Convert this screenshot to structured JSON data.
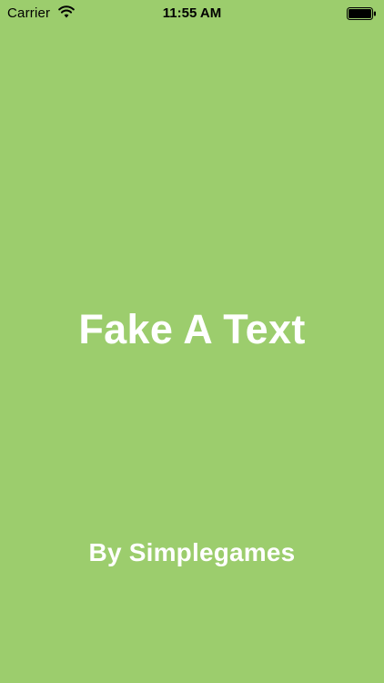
{
  "status_bar": {
    "carrier": "Carrier",
    "time": "11:55 AM",
    "wifi_icon": "wifi-icon",
    "battery_icon": "battery-icon"
  },
  "splash": {
    "title": "Fake A Text",
    "byline": "By Simplegames"
  },
  "colors": {
    "background": "#9ccd6d",
    "text": "#ffffff",
    "status_text": "#000000"
  }
}
